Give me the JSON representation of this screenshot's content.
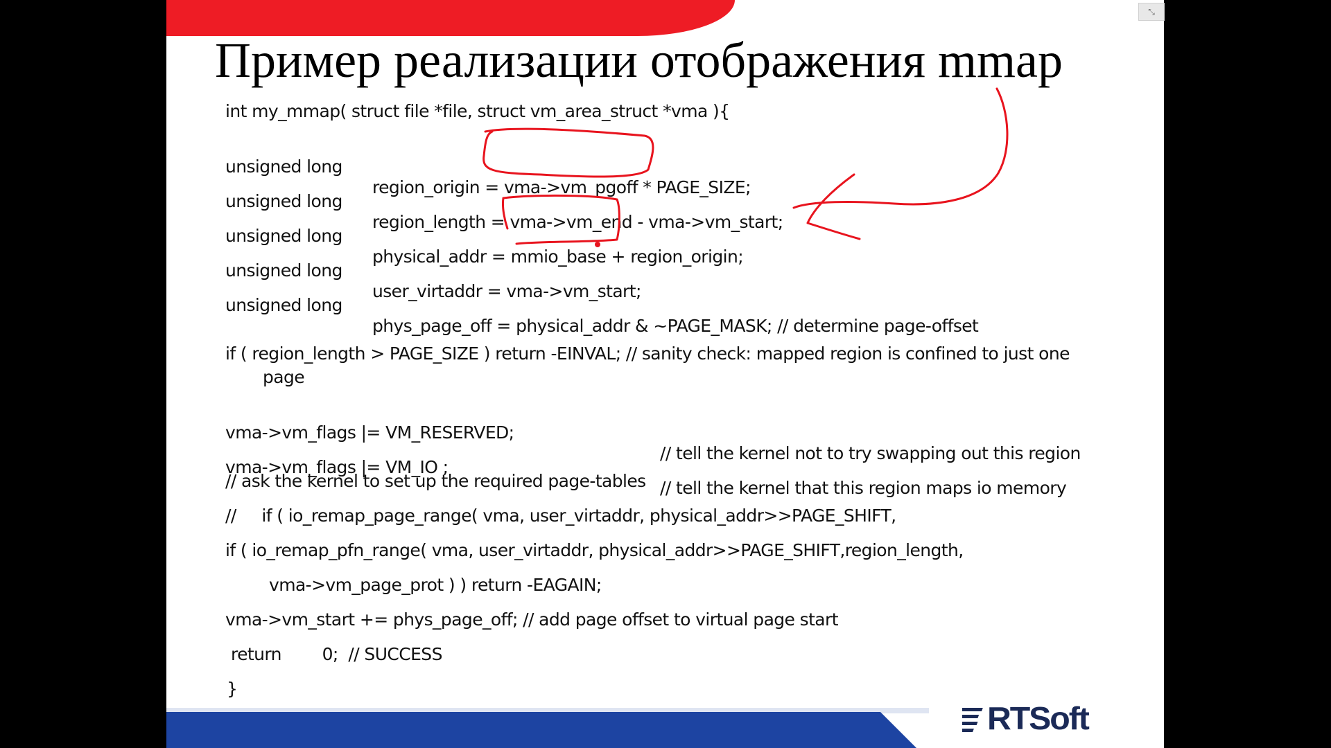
{
  "slide": {
    "title": "Пример реализации отображения mmap",
    "code": {
      "header": "int my_mmap( struct file *file, struct vm_area_struct *vma ){",
      "declarations": [
        {
          "type": "unsigned long",
          "statement": "region_origin = vma->vm_pgoff * PAGE_SIZE;"
        },
        {
          "type": "unsigned long",
          "statement": "region_length = vma->vm_end - vma->vm_start;"
        },
        {
          "type": "unsigned long",
          "statement": "physical_addr = mmio_base + region_origin;"
        },
        {
          "type": "unsigned long",
          "statement": "user_virtaddr = vma->vm_start;"
        },
        {
          "type": "unsigned long",
          "statement": "phys_page_off = physical_addr & ~PAGE_MASK; // determine page-offset"
        }
      ],
      "sanity_check_line1": "if ( region_length > PAGE_SIZE ) return -EINVAL; // sanity check: mapped region is confined to just one",
      "sanity_check_line2": "page",
      "flags": [
        {
          "statement": "vma->vm_flags |= VM_RESERVED;",
          "comment": "// tell the kernel not to try swapping out this region"
        },
        {
          "statement": "vma->vm_flags |= VM_IO ;",
          "comment": "// tell the kernel that this region maps io memory"
        }
      ],
      "page_tables_comment": "// ask the kernel to set up the required page-tables",
      "commented_remap": "//     if ( io_remap_page_range( vma, user_virtaddr, physical_addr>>PAGE_SHIFT,",
      "remap_line1": "if ( io_remap_pfn_range( vma, user_virtaddr, physical_addr>>PAGE_SHIFT,region_length,",
      "remap_line2": "vma->vm_page_prot ) ) return -EAGAIN;",
      "vm_start_line": "vma->vm_start += phys_page_off; // add page offset to virtual page start",
      "return_line": "return        0;  // SUCCESS",
      "closing_brace": "}"
    },
    "logo": {
      "text": "RTSoft"
    },
    "colors": {
      "top_band": "#ee1c25",
      "bottom_band": "#1d44a2",
      "annotation": "#e8141e",
      "logo": "#1b2a57"
    }
  },
  "window": {
    "close_icon": "close-icon",
    "close_glyph": "⤡"
  }
}
